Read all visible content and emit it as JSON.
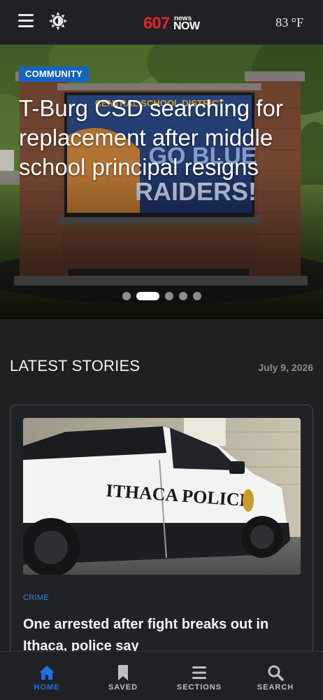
{
  "header": {
    "logo": {
      "number": "607",
      "word_top": "news",
      "word_bottom": "NOW"
    },
    "weather": "83 °F"
  },
  "hero": {
    "category": "COMMUNITY",
    "title": "T-Burg CSD searching for replacement after middle school principal resigns",
    "sign_lines": [
      "CENTRAL SCHOOL DISTRICT",
      "GO BLUE",
      "RAIDERS!"
    ],
    "slide_count": 5,
    "active_slide": 2
  },
  "latest": {
    "heading": "LATEST STORIES",
    "date": "July 9, 2026",
    "stories": [
      {
        "category": "CRIME",
        "headline": "One arrested after fight breaks out in Ithaca, police say",
        "image_text": "ITHACA POLICE"
      }
    ]
  },
  "bottom_nav": [
    {
      "label": "HOME",
      "icon": "home-icon",
      "active": true
    },
    {
      "label": "SAVED",
      "icon": "bookmark-icon",
      "active": false
    },
    {
      "label": "SECTIONS",
      "icon": "sections-menu-icon",
      "active": false
    },
    {
      "label": "SEARCH",
      "icon": "search-icon",
      "active": false
    }
  ],
  "colors": {
    "background": "#1f2022",
    "accent": "#1f6fe0",
    "badge": "#1565c0",
    "logo_red": "#e1252b"
  }
}
